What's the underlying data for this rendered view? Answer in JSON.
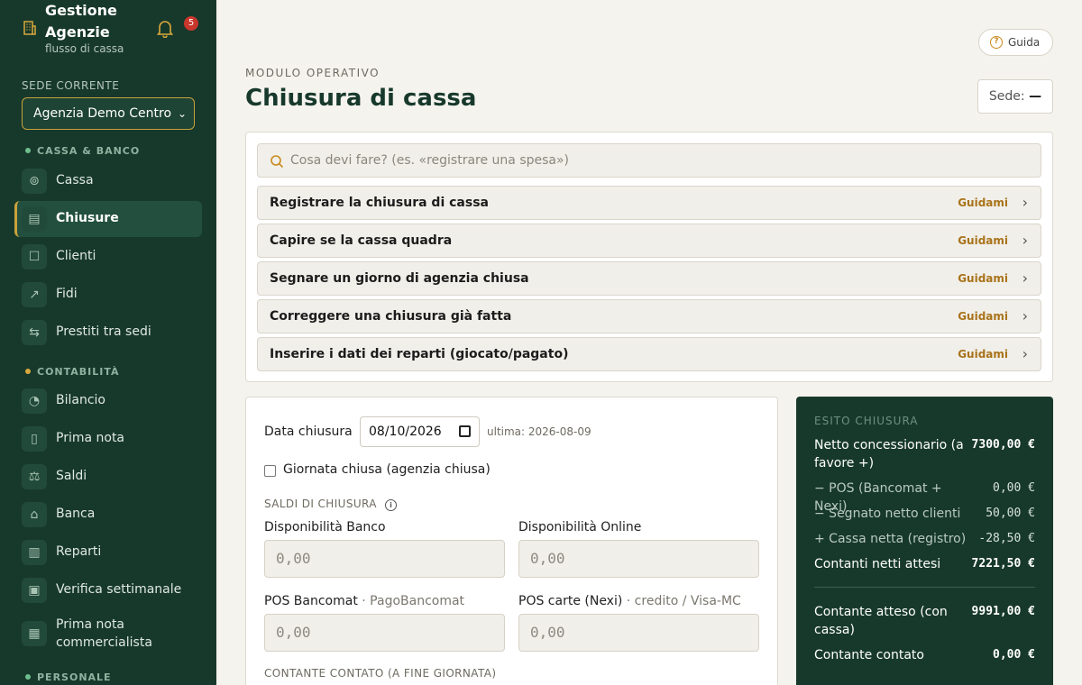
{
  "sidebar": {
    "brand_title": "Gestione Agenzie",
    "brand_sub": "flusso di cassa",
    "notifications": "5",
    "sede_label": "SEDE CORRENTE",
    "sede_value": "Agenzia Demo Centro",
    "sections": [
      {
        "title": "CASSA & BANCO",
        "items": [
          {
            "label": "Cassa",
            "icon": "coins-icon"
          },
          {
            "label": "Chiusure",
            "icon": "clipboard-icon",
            "active": true
          },
          {
            "label": "Clienti",
            "icon": "contact-icon"
          },
          {
            "label": "Fidi",
            "icon": "trend-icon"
          },
          {
            "label": "Prestiti tra sedi",
            "icon": "transfer-icon"
          }
        ]
      },
      {
        "title": "CONTABILITÀ",
        "items": [
          {
            "label": "Bilancio",
            "icon": "pie-icon"
          },
          {
            "label": "Prima nota",
            "icon": "book-icon"
          },
          {
            "label": "Saldi",
            "icon": "scale-icon"
          },
          {
            "label": "Banca",
            "icon": "bank-icon"
          },
          {
            "label": "Reparti",
            "icon": "bar-chart-icon"
          },
          {
            "label": "Verifica settimanale",
            "icon": "calendar-check-icon"
          },
          {
            "label": "Prima nota commercialista",
            "icon": "document-icon"
          }
        ]
      },
      {
        "title": "PERSONALE",
        "items": []
      }
    ]
  },
  "header": {
    "guida": "Guida",
    "kicker": "MODULO OPERATIVO",
    "title": "Chiusura di cassa",
    "sede_prefix": "Sede:",
    "sede_value": "—"
  },
  "guide": {
    "search_placeholder": "Cosa devi fare? (es. «registrare una spesa»)",
    "cta": "Guidami",
    "rows": [
      "Registrare la chiusura di cassa",
      "Capire se la cassa quadra",
      "Segnare un giorno di agenzia chiusa",
      "Correggere una chiusura già fatta",
      "Inserire i dati dei reparti (giocato/pagato)"
    ]
  },
  "form": {
    "date_label": "Data chiusura",
    "date_value": "08/10/2026",
    "last_date": "ultima: 2026-08-09",
    "closed_label": "Giornata chiusa (agenzia chiusa)",
    "saldi_caption": "SALDI DI CHIUSURA",
    "banco_label": "Disponibilità Banco",
    "online_label": "Disponibilità Online",
    "pos_label": "POS Bancomat",
    "pos_sub": " · PagoBancomat",
    "nexi_label": "POS carte (Nexi)",
    "nexi_sub": " · credito / Visa-MC",
    "placeholder": "0,00",
    "contante_caption": "CONTANTE CONTATO (A FINE GIORNATA)"
  },
  "esito": {
    "title": "ESITO CHIUSURA",
    "rows": [
      {
        "label": "Netto concessionario (a favore +)",
        "value": "7300,00 €"
      },
      {
        "label": "− POS (Bancomat + Nexi)",
        "value": "0,00 €"
      },
      {
        "label": "− Segnato netto clienti",
        "value": "50,00 €"
      },
      {
        "label": "+ Cassa netta (registro)",
        "value": "-28,50 €"
      },
      {
        "label": "Contanti netti attesi",
        "value": "7221,50 €"
      },
      {
        "label": "Contante atteso (con cassa)",
        "value": "9991,00 €"
      },
      {
        "label": "Contante contato",
        "value": "0,00 €"
      }
    ]
  },
  "colors": {
    "sidebar": "#17392c",
    "accent": "#c9a13b",
    "background": "#f5f3ee"
  }
}
